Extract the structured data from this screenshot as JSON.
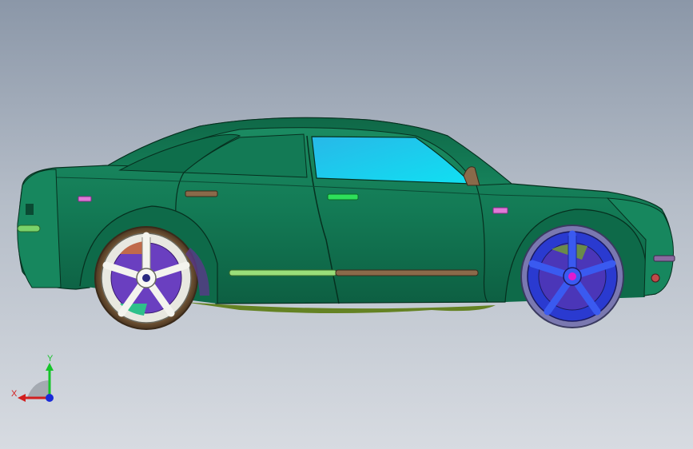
{
  "viewport": {
    "model": "sedan-side-view"
  },
  "triad": {
    "x_label": "X",
    "y_label": "Y"
  },
  "colors": {
    "body": "#127a55",
    "body_dark": "#0b5a3d",
    "window": "#1ed4f0",
    "x_axis": "#d21f1f",
    "y_axis": "#16c42a",
    "z_axis": "#1a2bd8"
  }
}
